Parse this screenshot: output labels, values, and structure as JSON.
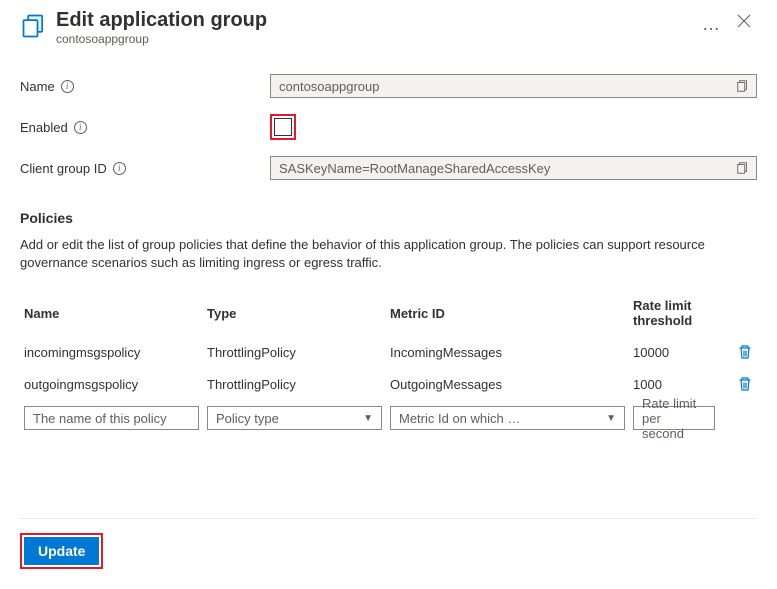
{
  "header": {
    "title": "Edit application group",
    "subtitle": "contosoappgroup",
    "more": "…"
  },
  "form": {
    "name_label": "Name",
    "name_value": "contosoappgroup",
    "enabled_label": "Enabled",
    "client_group_label": "Client group ID",
    "client_group_value": "SASKeyName=RootManageSharedAccessKey"
  },
  "policies": {
    "title": "Policies",
    "description": "Add or edit the list of group policies that define the behavior of this application group. The policies can support resource governance scenarios such as limiting ingress or egress traffic.",
    "columns": {
      "name": "Name",
      "type": "Type",
      "metric": "Metric ID",
      "threshold": "Rate limit threshold"
    },
    "rows": [
      {
        "name": "incomingmsgspolicy",
        "type": "ThrottlingPolicy",
        "metric": "IncomingMessages",
        "threshold": "10000"
      },
      {
        "name": "outgoingmsgspolicy",
        "type": "ThrottlingPolicy",
        "metric": "OutgoingMessages",
        "threshold": "1000"
      }
    ],
    "inputs": {
      "name_ph": "The name of this policy",
      "type_ph": "Policy type",
      "metric_ph": "Metric Id on which …",
      "threshold_ph": "Rate limit per second"
    }
  },
  "footer": {
    "update": "Update"
  }
}
